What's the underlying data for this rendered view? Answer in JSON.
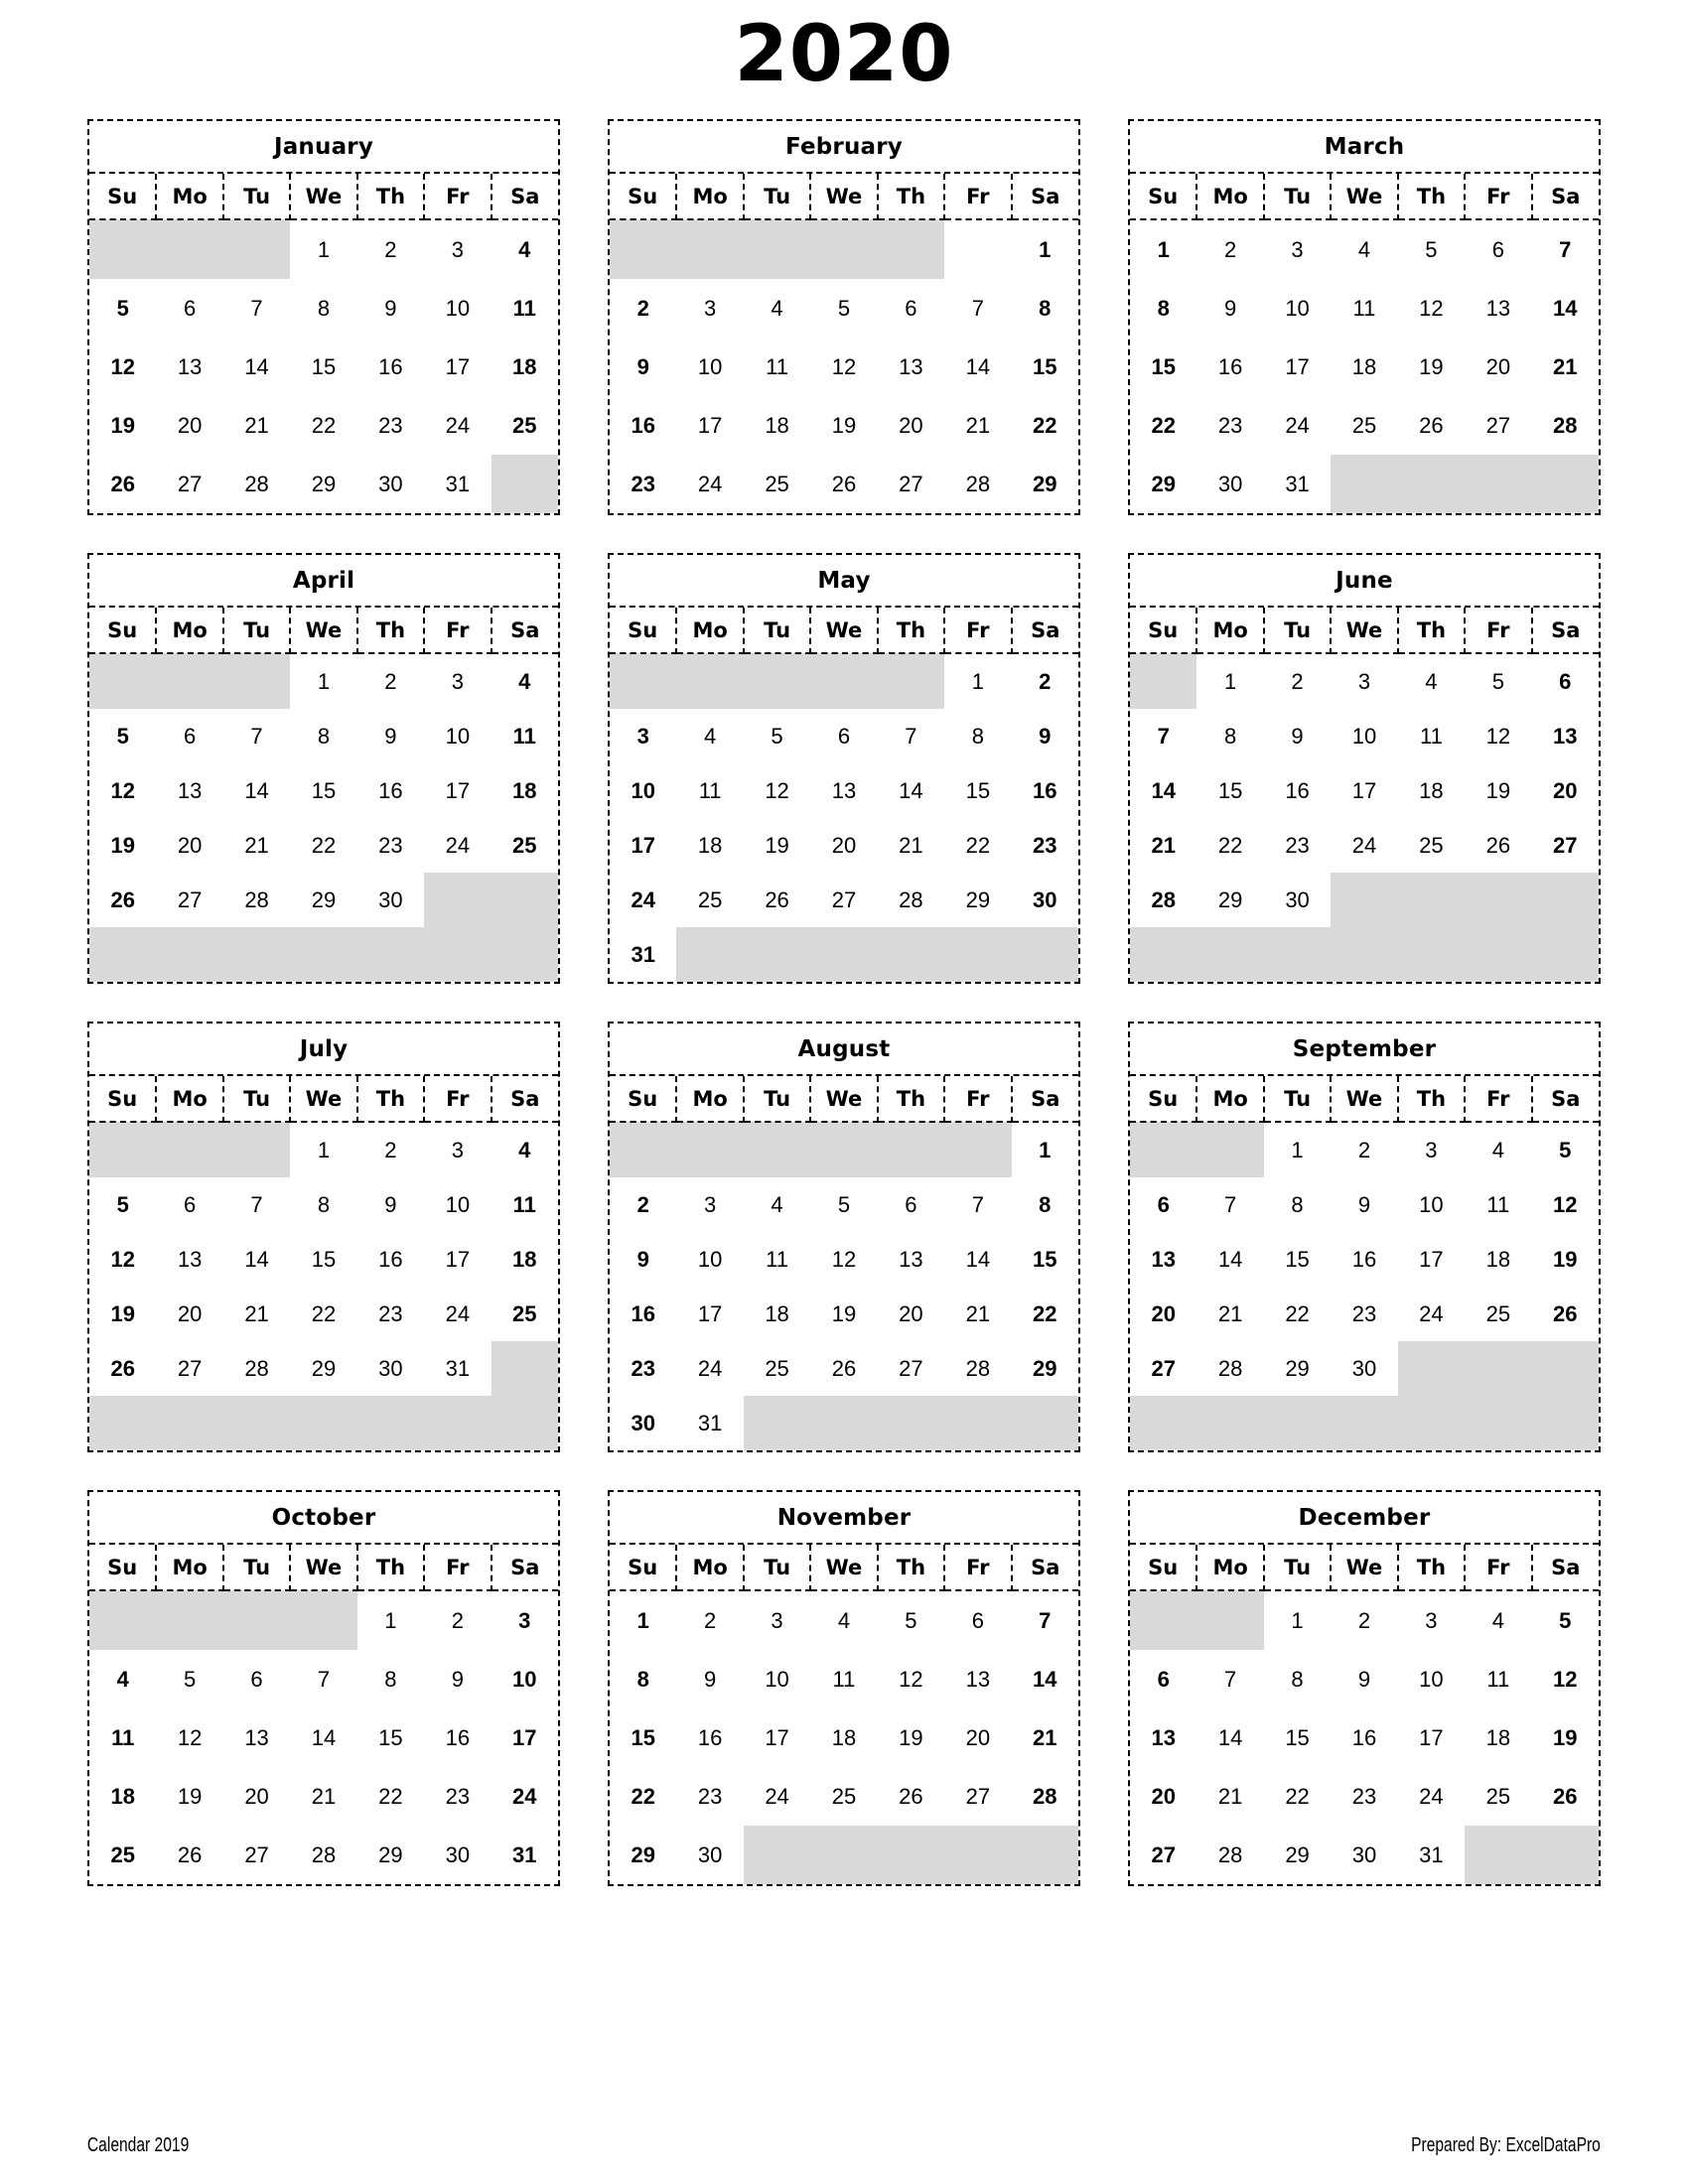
{
  "title": "2020",
  "weekday_headers": [
    "Su",
    "Mo",
    "Tu",
    "We",
    "Th",
    "Fr",
    "Sa"
  ],
  "colors": {
    "shaded_cell": "#d9d9d9",
    "border": "#000000",
    "text": "#000000",
    "background": "#ffffff"
  },
  "footer": {
    "left": "Calendar 2019",
    "right": "Prepared By: ExcelDataPro"
  },
  "months": [
    {
      "name": "January",
      "weeks": [
        [
          "",
          "",
          "",
          "1",
          "2",
          "3",
          "4"
        ],
        [
          "5",
          "6",
          "7",
          "8",
          "9",
          "10",
          "11"
        ],
        [
          "12",
          "13",
          "14",
          "15",
          "16",
          "17",
          "18"
        ],
        [
          "19",
          "20",
          "21",
          "22",
          "23",
          "24",
          "25"
        ],
        [
          "26",
          "27",
          "28",
          "29",
          "30",
          "31",
          ""
        ]
      ],
      "shaded": [
        [
          true,
          true,
          true,
          false,
          false,
          false,
          false
        ],
        [
          false,
          false,
          false,
          false,
          false,
          false,
          false
        ],
        [
          false,
          false,
          false,
          false,
          false,
          false,
          false
        ],
        [
          false,
          false,
          false,
          false,
          false,
          false,
          false
        ],
        [
          false,
          false,
          false,
          false,
          false,
          false,
          true
        ]
      ]
    },
    {
      "name": "February",
      "weeks": [
        [
          "",
          "",
          "",
          "",
          "",
          "",
          "1"
        ],
        [
          "2",
          "3",
          "4",
          "5",
          "6",
          "7",
          "8"
        ],
        [
          "9",
          "10",
          "11",
          "12",
          "13",
          "14",
          "15"
        ],
        [
          "16",
          "17",
          "18",
          "19",
          "20",
          "21",
          "22"
        ],
        [
          "23",
          "24",
          "25",
          "26",
          "27",
          "28",
          "29"
        ]
      ],
      "shaded": [
        [
          true,
          true,
          true,
          true,
          true,
          false,
          false
        ],
        [
          false,
          false,
          false,
          false,
          false,
          false,
          false
        ],
        [
          false,
          false,
          false,
          false,
          false,
          false,
          false
        ],
        [
          false,
          false,
          false,
          false,
          false,
          false,
          false
        ],
        [
          false,
          false,
          false,
          false,
          false,
          false,
          false
        ]
      ]
    },
    {
      "name": "March",
      "weeks": [
        [
          "1",
          "2",
          "3",
          "4",
          "5",
          "6",
          "7"
        ],
        [
          "8",
          "9",
          "10",
          "11",
          "12",
          "13",
          "14"
        ],
        [
          "15",
          "16",
          "17",
          "18",
          "19",
          "20",
          "21"
        ],
        [
          "22",
          "23",
          "24",
          "25",
          "26",
          "27",
          "28"
        ],
        [
          "29",
          "30",
          "31",
          "",
          "",
          "",
          ""
        ]
      ],
      "shaded": [
        [
          false,
          false,
          false,
          false,
          false,
          false,
          false
        ],
        [
          false,
          false,
          false,
          false,
          false,
          false,
          false
        ],
        [
          false,
          false,
          false,
          false,
          false,
          false,
          false
        ],
        [
          false,
          false,
          false,
          false,
          false,
          false,
          false
        ],
        [
          false,
          false,
          false,
          true,
          true,
          true,
          true
        ]
      ]
    },
    {
      "name": "April",
      "weeks": [
        [
          "",
          "",
          "",
          "1",
          "2",
          "3",
          "4"
        ],
        [
          "5",
          "6",
          "7",
          "8",
          "9",
          "10",
          "11"
        ],
        [
          "12",
          "13",
          "14",
          "15",
          "16",
          "17",
          "18"
        ],
        [
          "19",
          "20",
          "21",
          "22",
          "23",
          "24",
          "25"
        ],
        [
          "26",
          "27",
          "28",
          "29",
          "30",
          "",
          ""
        ],
        [
          "",
          "",
          "",
          "",
          "",
          "",
          ""
        ]
      ],
      "shaded": [
        [
          true,
          true,
          true,
          false,
          false,
          false,
          false
        ],
        [
          false,
          false,
          false,
          false,
          false,
          false,
          false
        ],
        [
          false,
          false,
          false,
          false,
          false,
          false,
          false
        ],
        [
          false,
          false,
          false,
          false,
          false,
          false,
          false
        ],
        [
          false,
          false,
          false,
          false,
          false,
          true,
          true
        ],
        [
          true,
          true,
          true,
          true,
          true,
          true,
          true
        ]
      ]
    },
    {
      "name": "May",
      "weeks": [
        [
          "",
          "",
          "",
          "",
          "",
          "1",
          "2"
        ],
        [
          "3",
          "4",
          "5",
          "6",
          "7",
          "8",
          "9"
        ],
        [
          "10",
          "11",
          "12",
          "13",
          "14",
          "15",
          "16"
        ],
        [
          "17",
          "18",
          "19",
          "20",
          "21",
          "22",
          "23"
        ],
        [
          "24",
          "25",
          "26",
          "27",
          "28",
          "29",
          "30"
        ],
        [
          "31",
          "",
          "",
          "",
          "",
          "",
          ""
        ]
      ],
      "shaded": [
        [
          true,
          true,
          true,
          true,
          true,
          false,
          false
        ],
        [
          false,
          false,
          false,
          false,
          false,
          false,
          false
        ],
        [
          false,
          false,
          false,
          false,
          false,
          false,
          false
        ],
        [
          false,
          false,
          false,
          false,
          false,
          false,
          false
        ],
        [
          false,
          false,
          false,
          false,
          false,
          false,
          false
        ],
        [
          false,
          true,
          true,
          true,
          true,
          true,
          true
        ]
      ]
    },
    {
      "name": "June",
      "weeks": [
        [
          "",
          "1",
          "2",
          "3",
          "4",
          "5",
          "6"
        ],
        [
          "7",
          "8",
          "9",
          "10",
          "11",
          "12",
          "13"
        ],
        [
          "14",
          "15",
          "16",
          "17",
          "18",
          "19",
          "20"
        ],
        [
          "21",
          "22",
          "23",
          "24",
          "25",
          "26",
          "27"
        ],
        [
          "28",
          "29",
          "30",
          "",
          "",
          "",
          ""
        ],
        [
          "",
          "",
          "",
          "",
          "",
          "",
          ""
        ]
      ],
      "shaded": [
        [
          true,
          false,
          false,
          false,
          false,
          false,
          false
        ],
        [
          false,
          false,
          false,
          false,
          false,
          false,
          false
        ],
        [
          false,
          false,
          false,
          false,
          false,
          false,
          false
        ],
        [
          false,
          false,
          false,
          false,
          false,
          false,
          false
        ],
        [
          false,
          false,
          false,
          true,
          true,
          true,
          true
        ],
        [
          true,
          true,
          true,
          true,
          true,
          true,
          true
        ]
      ]
    },
    {
      "name": "July",
      "weeks": [
        [
          "",
          "",
          "",
          "1",
          "2",
          "3",
          "4"
        ],
        [
          "5",
          "6",
          "7",
          "8",
          "9",
          "10",
          "11"
        ],
        [
          "12",
          "13",
          "14",
          "15",
          "16",
          "17",
          "18"
        ],
        [
          "19",
          "20",
          "21",
          "22",
          "23",
          "24",
          "25"
        ],
        [
          "26",
          "27",
          "28",
          "29",
          "30",
          "31",
          ""
        ],
        [
          "",
          "",
          "",
          "",
          "",
          "",
          ""
        ]
      ],
      "shaded": [
        [
          true,
          true,
          true,
          false,
          false,
          false,
          false
        ],
        [
          false,
          false,
          false,
          false,
          false,
          false,
          false
        ],
        [
          false,
          false,
          false,
          false,
          false,
          false,
          false
        ],
        [
          false,
          false,
          false,
          false,
          false,
          false,
          false
        ],
        [
          false,
          false,
          false,
          false,
          false,
          false,
          true
        ],
        [
          true,
          true,
          true,
          true,
          true,
          true,
          true
        ]
      ]
    },
    {
      "name": "August",
      "weeks": [
        [
          "",
          "",
          "",
          "",
          "",
          "",
          "1"
        ],
        [
          "2",
          "3",
          "4",
          "5",
          "6",
          "7",
          "8"
        ],
        [
          "9",
          "10",
          "11",
          "12",
          "13",
          "14",
          "15"
        ],
        [
          "16",
          "17",
          "18",
          "19",
          "20",
          "21",
          "22"
        ],
        [
          "23",
          "24",
          "25",
          "26",
          "27",
          "28",
          "29"
        ],
        [
          "30",
          "31",
          "",
          "",
          "",
          "",
          ""
        ]
      ],
      "shaded": [
        [
          true,
          true,
          true,
          true,
          true,
          true,
          false
        ],
        [
          false,
          false,
          false,
          false,
          false,
          false,
          false
        ],
        [
          false,
          false,
          false,
          false,
          false,
          false,
          false
        ],
        [
          false,
          false,
          false,
          false,
          false,
          false,
          false
        ],
        [
          false,
          false,
          false,
          false,
          false,
          false,
          false
        ],
        [
          false,
          false,
          true,
          true,
          true,
          true,
          true
        ]
      ]
    },
    {
      "name": "September",
      "weeks": [
        [
          "",
          "",
          "1",
          "2",
          "3",
          "4",
          "5"
        ],
        [
          "6",
          "7",
          "8",
          "9",
          "10",
          "11",
          "12"
        ],
        [
          "13",
          "14",
          "15",
          "16",
          "17",
          "18",
          "19"
        ],
        [
          "20",
          "21",
          "22",
          "23",
          "24",
          "25",
          "26"
        ],
        [
          "27",
          "28",
          "29",
          "30",
          "",
          "",
          ""
        ],
        [
          "",
          "",
          "",
          "",
          "",
          "",
          ""
        ]
      ],
      "shaded": [
        [
          true,
          true,
          false,
          false,
          false,
          false,
          false
        ],
        [
          false,
          false,
          false,
          false,
          false,
          false,
          false
        ],
        [
          false,
          false,
          false,
          false,
          false,
          false,
          false
        ],
        [
          false,
          false,
          false,
          false,
          false,
          false,
          false
        ],
        [
          false,
          false,
          false,
          false,
          true,
          true,
          true
        ],
        [
          true,
          true,
          true,
          true,
          true,
          true,
          true
        ]
      ]
    },
    {
      "name": "October",
      "weeks": [
        [
          "",
          "",
          "",
          "",
          "1",
          "2",
          "3"
        ],
        [
          "4",
          "5",
          "6",
          "7",
          "8",
          "9",
          "10"
        ],
        [
          "11",
          "12",
          "13",
          "14",
          "15",
          "16",
          "17"
        ],
        [
          "18",
          "19",
          "20",
          "21",
          "22",
          "23",
          "24"
        ],
        [
          "25",
          "26",
          "27",
          "28",
          "29",
          "30",
          "31"
        ]
      ],
      "shaded": [
        [
          true,
          true,
          true,
          true,
          false,
          false,
          false
        ],
        [
          false,
          false,
          false,
          false,
          false,
          false,
          false
        ],
        [
          false,
          false,
          false,
          false,
          false,
          false,
          false
        ],
        [
          false,
          false,
          false,
          false,
          false,
          false,
          false
        ],
        [
          false,
          false,
          false,
          false,
          false,
          false,
          false
        ]
      ]
    },
    {
      "name": "November",
      "weeks": [
        [
          "1",
          "2",
          "3",
          "4",
          "5",
          "6",
          "7"
        ],
        [
          "8",
          "9",
          "10",
          "11",
          "12",
          "13",
          "14"
        ],
        [
          "15",
          "16",
          "17",
          "18",
          "19",
          "20",
          "21"
        ],
        [
          "22",
          "23",
          "24",
          "25",
          "26",
          "27",
          "28"
        ],
        [
          "29",
          "30",
          "",
          "",
          "",
          "",
          ""
        ]
      ],
      "shaded": [
        [
          false,
          false,
          false,
          false,
          false,
          false,
          false
        ],
        [
          false,
          false,
          false,
          false,
          false,
          false,
          false
        ],
        [
          false,
          false,
          false,
          false,
          false,
          false,
          false
        ],
        [
          false,
          false,
          false,
          false,
          false,
          false,
          false
        ],
        [
          false,
          false,
          true,
          true,
          true,
          true,
          true
        ]
      ]
    },
    {
      "name": "December",
      "weeks": [
        [
          "",
          "",
          "1",
          "2",
          "3",
          "4",
          "5"
        ],
        [
          "6",
          "7",
          "8",
          "9",
          "10",
          "11",
          "12"
        ],
        [
          "13",
          "14",
          "15",
          "16",
          "17",
          "18",
          "19"
        ],
        [
          "20",
          "21",
          "22",
          "23",
          "24",
          "25",
          "26"
        ],
        [
          "27",
          "28",
          "29",
          "30",
          "31",
          "",
          ""
        ]
      ],
      "shaded": [
        [
          true,
          true,
          false,
          false,
          false,
          false,
          false
        ],
        [
          false,
          false,
          false,
          false,
          false,
          false,
          false
        ],
        [
          false,
          false,
          false,
          false,
          false,
          false,
          false
        ],
        [
          false,
          false,
          false,
          false,
          false,
          false,
          false
        ],
        [
          false,
          false,
          false,
          false,
          false,
          true,
          true
        ]
      ]
    }
  ]
}
